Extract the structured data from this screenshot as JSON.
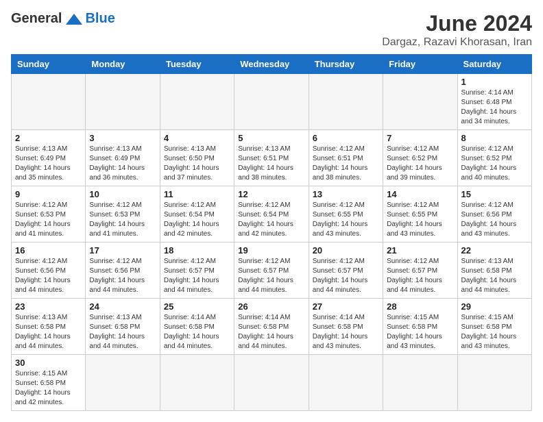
{
  "header": {
    "logo_general": "General",
    "logo_blue": "Blue",
    "month_title": "June 2024",
    "location": "Dargaz, Razavi Khorasan, Iran"
  },
  "weekdays": [
    "Sunday",
    "Monday",
    "Tuesday",
    "Wednesday",
    "Thursday",
    "Friday",
    "Saturday"
  ],
  "weeks": [
    [
      {
        "day": "",
        "info": ""
      },
      {
        "day": "",
        "info": ""
      },
      {
        "day": "",
        "info": ""
      },
      {
        "day": "",
        "info": ""
      },
      {
        "day": "",
        "info": ""
      },
      {
        "day": "",
        "info": ""
      },
      {
        "day": "1",
        "info": "Sunrise: 4:14 AM\nSunset: 6:48 PM\nDaylight: 14 hours\nand 34 minutes."
      }
    ],
    [
      {
        "day": "2",
        "info": "Sunrise: 4:13 AM\nSunset: 6:49 PM\nDaylight: 14 hours\nand 35 minutes."
      },
      {
        "day": "3",
        "info": "Sunrise: 4:13 AM\nSunset: 6:49 PM\nDaylight: 14 hours\nand 36 minutes."
      },
      {
        "day": "4",
        "info": "Sunrise: 4:13 AM\nSunset: 6:50 PM\nDaylight: 14 hours\nand 37 minutes."
      },
      {
        "day": "5",
        "info": "Sunrise: 4:13 AM\nSunset: 6:51 PM\nDaylight: 14 hours\nand 38 minutes."
      },
      {
        "day": "6",
        "info": "Sunrise: 4:12 AM\nSunset: 6:51 PM\nDaylight: 14 hours\nand 38 minutes."
      },
      {
        "day": "7",
        "info": "Sunrise: 4:12 AM\nSunset: 6:52 PM\nDaylight: 14 hours\nand 39 minutes."
      },
      {
        "day": "8",
        "info": "Sunrise: 4:12 AM\nSunset: 6:52 PM\nDaylight: 14 hours\nand 40 minutes."
      }
    ],
    [
      {
        "day": "9",
        "info": "Sunrise: 4:12 AM\nSunset: 6:53 PM\nDaylight: 14 hours\nand 41 minutes."
      },
      {
        "day": "10",
        "info": "Sunrise: 4:12 AM\nSunset: 6:53 PM\nDaylight: 14 hours\nand 41 minutes."
      },
      {
        "day": "11",
        "info": "Sunrise: 4:12 AM\nSunset: 6:54 PM\nDaylight: 14 hours\nand 42 minutes."
      },
      {
        "day": "12",
        "info": "Sunrise: 4:12 AM\nSunset: 6:54 PM\nDaylight: 14 hours\nand 42 minutes."
      },
      {
        "day": "13",
        "info": "Sunrise: 4:12 AM\nSunset: 6:55 PM\nDaylight: 14 hours\nand 43 minutes."
      },
      {
        "day": "14",
        "info": "Sunrise: 4:12 AM\nSunset: 6:55 PM\nDaylight: 14 hours\nand 43 minutes."
      },
      {
        "day": "15",
        "info": "Sunrise: 4:12 AM\nSunset: 6:56 PM\nDaylight: 14 hours\nand 43 minutes."
      }
    ],
    [
      {
        "day": "16",
        "info": "Sunrise: 4:12 AM\nSunset: 6:56 PM\nDaylight: 14 hours\nand 44 minutes."
      },
      {
        "day": "17",
        "info": "Sunrise: 4:12 AM\nSunset: 6:56 PM\nDaylight: 14 hours\nand 44 minutes."
      },
      {
        "day": "18",
        "info": "Sunrise: 4:12 AM\nSunset: 6:57 PM\nDaylight: 14 hours\nand 44 minutes."
      },
      {
        "day": "19",
        "info": "Sunrise: 4:12 AM\nSunset: 6:57 PM\nDaylight: 14 hours\nand 44 minutes."
      },
      {
        "day": "20",
        "info": "Sunrise: 4:12 AM\nSunset: 6:57 PM\nDaylight: 14 hours\nand 44 minutes."
      },
      {
        "day": "21",
        "info": "Sunrise: 4:12 AM\nSunset: 6:57 PM\nDaylight: 14 hours\nand 44 minutes."
      },
      {
        "day": "22",
        "info": "Sunrise: 4:13 AM\nSunset: 6:58 PM\nDaylight: 14 hours\nand 44 minutes."
      }
    ],
    [
      {
        "day": "23",
        "info": "Sunrise: 4:13 AM\nSunset: 6:58 PM\nDaylight: 14 hours\nand 44 minutes."
      },
      {
        "day": "24",
        "info": "Sunrise: 4:13 AM\nSunset: 6:58 PM\nDaylight: 14 hours\nand 44 minutes."
      },
      {
        "day": "25",
        "info": "Sunrise: 4:14 AM\nSunset: 6:58 PM\nDaylight: 14 hours\nand 44 minutes."
      },
      {
        "day": "26",
        "info": "Sunrise: 4:14 AM\nSunset: 6:58 PM\nDaylight: 14 hours\nand 44 minutes."
      },
      {
        "day": "27",
        "info": "Sunrise: 4:14 AM\nSunset: 6:58 PM\nDaylight: 14 hours\nand 43 minutes."
      },
      {
        "day": "28",
        "info": "Sunrise: 4:15 AM\nSunset: 6:58 PM\nDaylight: 14 hours\nand 43 minutes."
      },
      {
        "day": "29",
        "info": "Sunrise: 4:15 AM\nSunset: 6:58 PM\nDaylight: 14 hours\nand 43 minutes."
      }
    ],
    [
      {
        "day": "30",
        "info": "Sunrise: 4:15 AM\nSunset: 6:58 PM\nDaylight: 14 hours\nand 42 minutes."
      },
      {
        "day": "",
        "info": ""
      },
      {
        "day": "",
        "info": ""
      },
      {
        "day": "",
        "info": ""
      },
      {
        "day": "",
        "info": ""
      },
      {
        "day": "",
        "info": ""
      },
      {
        "day": "",
        "info": ""
      }
    ]
  ]
}
